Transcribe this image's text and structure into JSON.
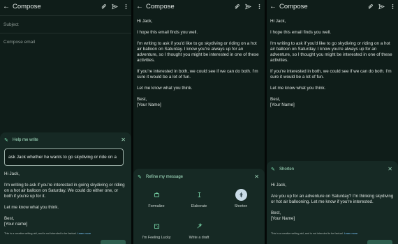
{
  "app": {
    "title": "Compose",
    "back_glyph": "←",
    "close_glyph": "✕"
  },
  "toolbar_icons": [
    "attach-icon",
    "send-icon",
    "more-vert-icon"
  ],
  "panel1": {
    "subject_placeholder": "Subject",
    "body_placeholder": "Compose email",
    "sheet": {
      "title": "Help me write",
      "prompt_value": "ask Jack whether he wants to go skydiving or ride on a",
      "generated": [
        "Hi Jack,",
        "I'm writing to ask if you're interested in going skydiving or riding on a hot air balloon on Saturday. We could do either one, or both if you're up for it.",
        "Let me know what you think.",
        "Best,",
        "[Your name]"
      ],
      "disclaimer": "This is a creative writing aid, and is not intended to be factual.",
      "learn_more": "Learn more"
    }
  },
  "panel2": {
    "body": [
      "Hi Jack,",
      "I hope this email finds you well.",
      "I'm writing to ask if you'd like to go skydiving or riding on a hot air balloon on Saturday. I know you're always up for an adventure, so I thought you might be interested in one of these activities.",
      "If you're interested in both, we could see if we can do both. I'm sure it would be a lot of fun.",
      "Let me know what you think.",
      "Best,",
      "[Your Name]"
    ],
    "sheet": {
      "title": "Refine my message",
      "options": [
        {
          "label": "Formalize",
          "icon": "briefcase-icon",
          "selected": false
        },
        {
          "label": "Elaborate",
          "icon": "text-cursor-icon",
          "selected": false
        },
        {
          "label": "Shorten",
          "icon": "shrink-icon",
          "selected": true
        },
        {
          "label": "I'm Feeling Lucky",
          "icon": "dice-icon",
          "selected": false
        },
        {
          "label": "Write a draft",
          "icon": "sparkle-pen-icon",
          "selected": false
        }
      ]
    }
  },
  "panel3": {
    "body": [
      "Hi Jack,",
      "I hope this email finds you well.",
      "I'm writing to ask if you'd like to go skydiving or riding on a hot air balloon on Saturday. I know you're always up for an adventure, so I thought you might be interested in one of these activities.",
      "If you're interested in both, we could see if we can do both. I'm sure it would be a lot of fun.",
      "Let me know what you think.",
      "Best,",
      "[Your Name]"
    ],
    "sheet": {
      "title": "Shorten",
      "generated": [
        "Hi Jack,",
        "Are you up for an adventure on Saturday? I'm thinking skydiving or hot air ballooning. Let me know if you're interested.",
        "Best,",
        "[Your Name]"
      ],
      "disclaimer": "This is a creative writing aid, and is not intended to be factual.",
      "learn_more": "Learn more"
    }
  },
  "colors": {
    "background": "#0f1d19",
    "sheet": "#162924",
    "accent": "#7fe0b0",
    "selected_chip": "#c9dbe6"
  }
}
